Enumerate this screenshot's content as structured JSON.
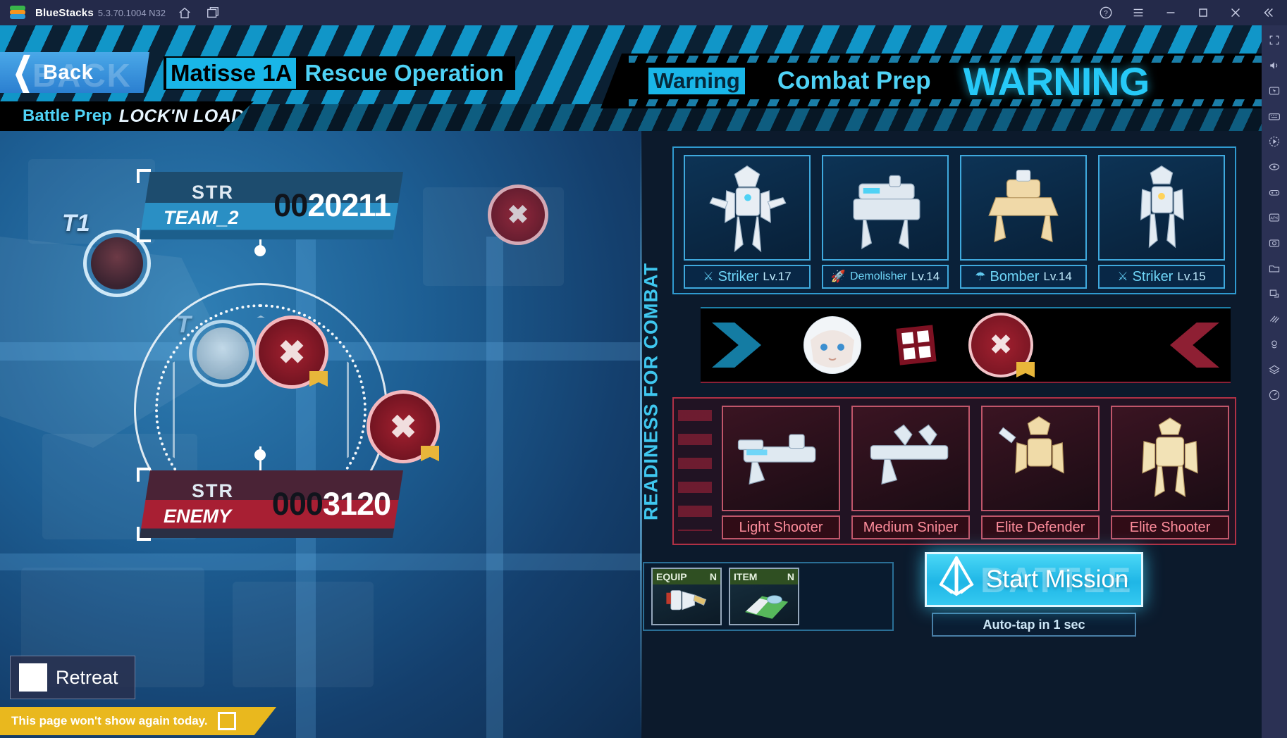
{
  "bluestacks": {
    "app_name": "BlueStacks",
    "version": "5.3.70.1004 N32",
    "home_icon": "home-icon",
    "multi_instance_icon": "multi-instance-icon",
    "help_icon": "help-icon",
    "menu_icon": "hamburger-menu-icon",
    "minimize_icon": "minimize-icon",
    "maximize_icon": "maximize-icon",
    "close_icon": "close-icon",
    "collapse_icon": "collapse-icon",
    "sidebar_icons": [
      "fullscreen-icon",
      "volume-icon",
      "cursor-icon",
      "keyboard-icon",
      "macro-play-icon",
      "rotate-icon",
      "gamepad-icon",
      "apk-install-icon",
      "screenshot-icon",
      "folder-icon",
      "resize-icon",
      "shake-icon",
      "location-icon",
      "layers-icon",
      "speedometer-icon"
    ]
  },
  "header": {
    "back_label": "Back",
    "back_ghost": "BACK",
    "stage_code": "Matisse 1A",
    "stage_name": "Rescue Operation",
    "subtitle_a": "Battle Prep",
    "subtitle_b": "LOCK'N LOAD",
    "warning_small": "Warning",
    "combat_prep": "Combat Prep",
    "warning_big": "WARNING"
  },
  "map": {
    "team_panel": {
      "str_label": "STR",
      "team_label": "TEAM_2",
      "value_zeros": "00",
      "value": "20211"
    },
    "enemy_panel": {
      "str_label": "STR",
      "team_label": "ENEMY",
      "value_zeros": "000",
      "value": "3120"
    },
    "node_labels": [
      "T1",
      "T"
    ],
    "retreat_label": "Retreat",
    "retreat_icon": "exit-door-icon",
    "dont_show_label": "This page won't show again today.",
    "checkbox_name": "dont-show-checkbox"
  },
  "right": {
    "vertical_label": "READINESS FOR COMBAT",
    "ally_units": [
      {
        "name": "Striker",
        "level": "Lv.17",
        "icon": "crossed-swords-icon"
      },
      {
        "name": "Demolisher",
        "level": "Lv.14",
        "icon": "rocket-launcher-icon"
      },
      {
        "name": "Bomber",
        "level": "Lv.14",
        "icon": "mortar-icon"
      },
      {
        "name": "Striker",
        "level": "Lv.15",
        "icon": "crossed-swords-icon"
      }
    ],
    "enemy_units": [
      {
        "name": "Light Shooter"
      },
      {
        "name": "Medium Sniper"
      },
      {
        "name": "Elite Defender"
      },
      {
        "name": "Elite Shooter"
      }
    ],
    "vs_bar": {
      "ally_portrait": "ally-commander-portrait",
      "marker_icon": "grid-marker-icon",
      "enemy_icon": "crossed-rifles-icon"
    },
    "slots": [
      {
        "label": "EQUIP",
        "rarity": "N"
      },
      {
        "label": "ITEM",
        "rarity": "N"
      }
    ],
    "start_label": "Start Mission",
    "start_ghost": "BATTLE",
    "start_icon": "battle-emblem-icon",
    "autotap_label": "Auto-tap in 1 sec"
  },
  "colors": {
    "accent_cyan": "#19b6e8",
    "ally_blue": "#3fa9dd",
    "enemy_red": "#b03146",
    "warn_yellow": "#e9b81e"
  }
}
